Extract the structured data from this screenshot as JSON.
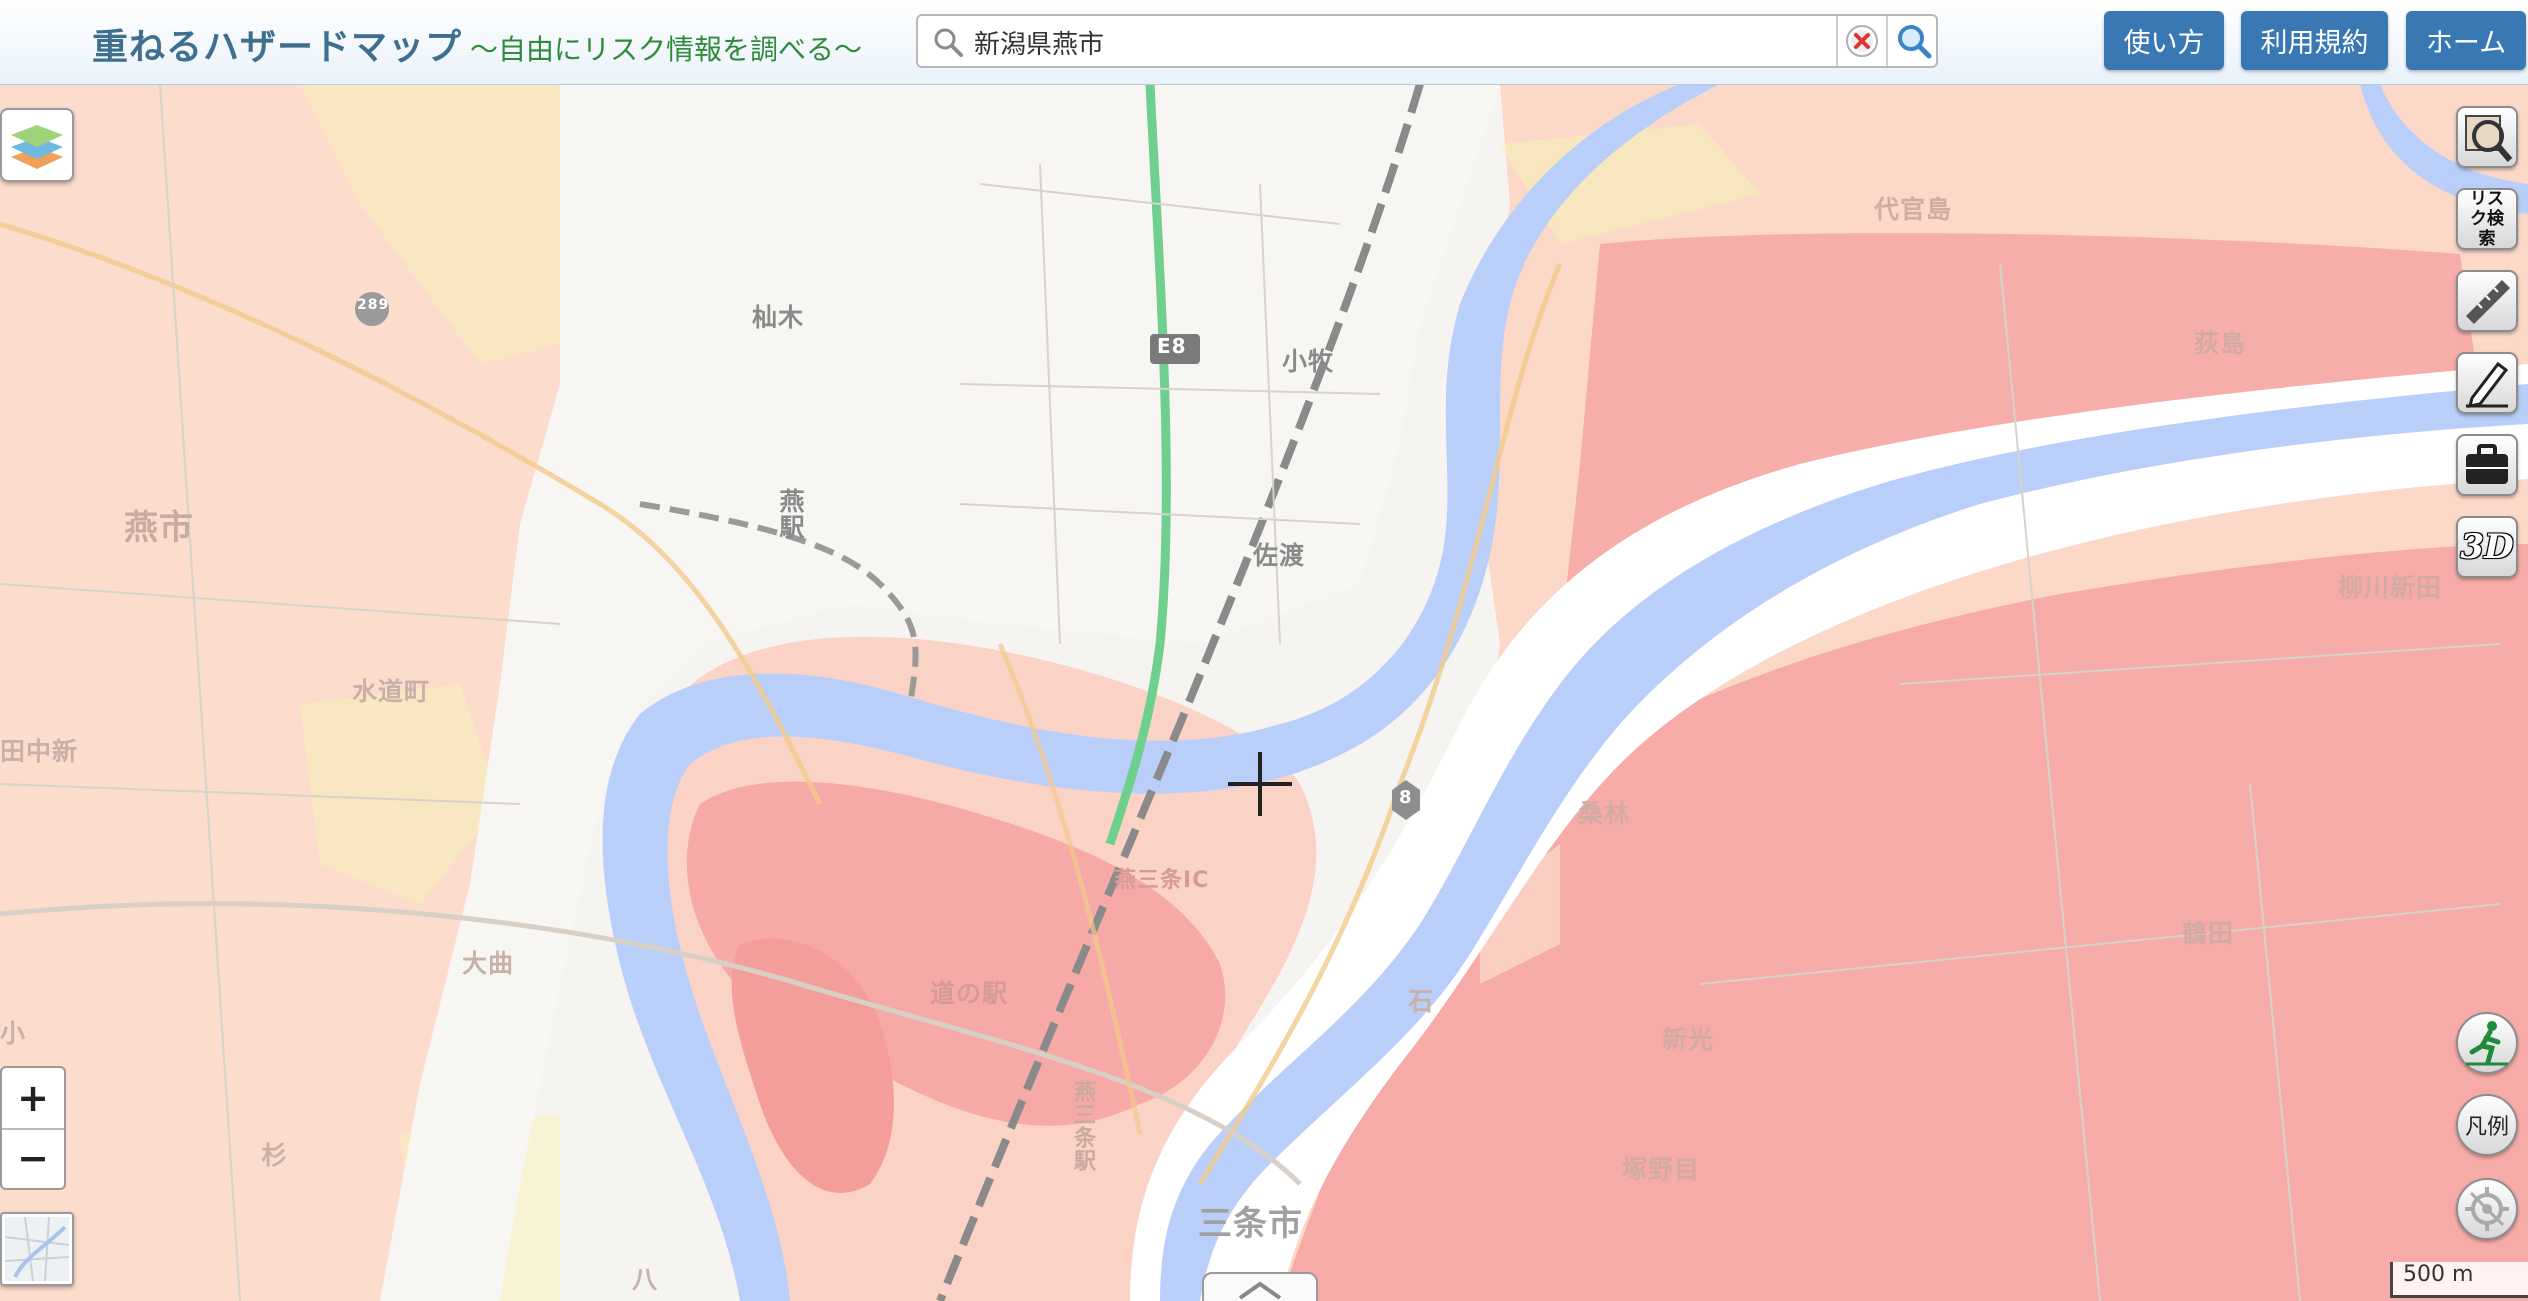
{
  "header": {
    "title": "重ねるハザードマップ",
    "subtitle": "～自由にリスク情報を調べる～",
    "search_value": "新潟県燕市",
    "buttons": {
      "usage": "使い方",
      "terms": "利用規約",
      "home": "ホーム"
    }
  },
  "map": {
    "places": {
      "yuzuki": "杣木",
      "tsubame_city": "燕市",
      "tsubame_station": "燕駅",
      "komaki": "小牧",
      "sado": "佐渡",
      "suidocho": "水道町",
      "tanakashin": "田中新",
      "omagari": "大曲",
      "sanjo_city": "三条市",
      "sanjo_station": "燕三条駅",
      "michinoeki": "道の駅",
      "sanjo_ic": "燕三条IC",
      "daikanjima": "代官島",
      "hagishima": "荻島",
      "yanagawa_shinden": "柳川新田",
      "kuwabayashi": "桑林",
      "tsuruta": "鶴田",
      "shinko": "新光",
      "isatsuka": "石",
      "tsukanome": "塚野目",
      "sugi": "杉",
      "yatsu": "八",
      "ko": "小",
      "route_e8": "E8",
      "route_8": "8",
      "route_289": "289"
    }
  },
  "tools": {
    "risk_search": "リスク検索",
    "three_d": "3D",
    "legend": "凡例"
  },
  "zoom": {
    "in": "+",
    "out": "−"
  },
  "scale": {
    "label": "500 m"
  },
  "colors": {
    "header_title": "#3f6f8f",
    "header_subtitle": "#2f8a3a",
    "button_blue": "#3a78b4",
    "river": "#b9cffa",
    "flood_light": "#fcdccc",
    "flood_mid": "#f9c0b4",
    "flood_deep": "#f6a1a0",
    "flood_yellow": "#f8f4b0",
    "expressway": "#6fcf8f"
  }
}
